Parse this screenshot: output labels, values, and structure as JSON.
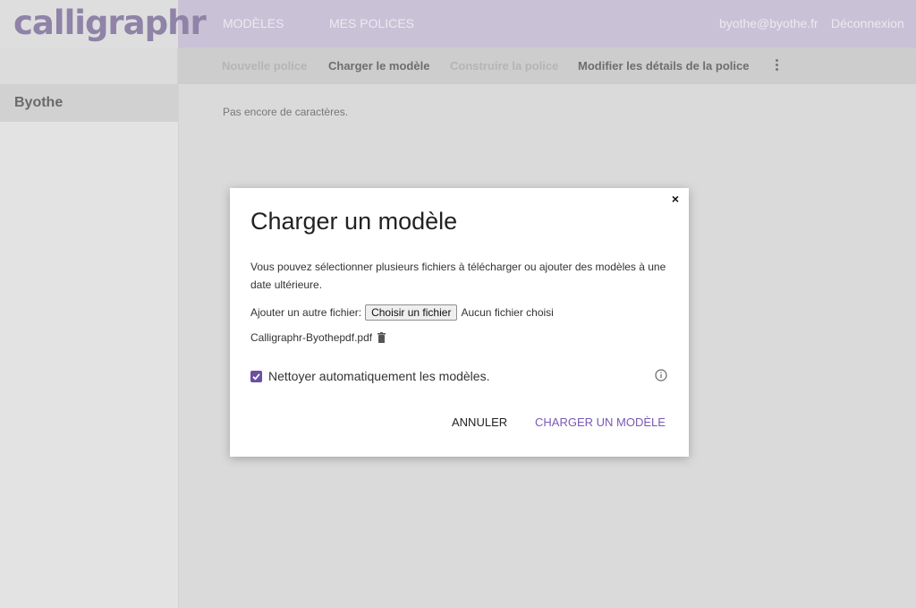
{
  "app": {
    "logo_text": "calligraphr"
  },
  "header": {
    "nav": [
      {
        "label": "Modèles"
      },
      {
        "label": "Mes polices"
      }
    ],
    "user_email": "byothe@byothe.fr",
    "logout_label": "Déconnexion"
  },
  "steps": {
    "new_font": "Nouvelle police",
    "upload_template": "Charger le modèle",
    "build_font": "Construire la police",
    "edit_details": "Modifier les détails de la police"
  },
  "sidebar": {
    "items": [
      {
        "label": "Byothe"
      }
    ]
  },
  "main": {
    "empty_text": "Pas encore de caractères."
  },
  "modal": {
    "close": "×",
    "title": "Charger un modèle",
    "description": "Vous pouvez sélectionner plusieurs fichiers à télécharger ou ajouter des modèles à une date ultérieure.",
    "add_file_label": "Ajouter un autre fichier:",
    "choose_file_button": "Choisir un fichier",
    "no_file_text": "Aucun fichier choisi",
    "uploaded_file": "Calligraphr-Byothepdf.pdf",
    "auto_clean_label": "Nettoyer automatiquement les modèles.",
    "auto_clean_checked": true,
    "cancel_label": "Annuler",
    "upload_label": "Charger un modèle"
  },
  "colors": {
    "header_bg": "#c9c2d6",
    "accent": "#7a58b5",
    "checkbox": "#6a4fa3"
  }
}
